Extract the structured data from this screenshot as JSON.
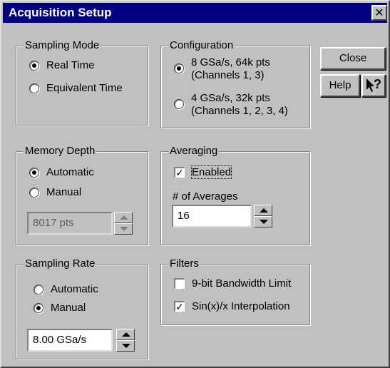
{
  "window": {
    "title": "Acquisition Setup",
    "close_glyph": "✕"
  },
  "sampling_mode": {
    "legend": "Sampling Mode",
    "options": [
      {
        "label": "Real Time",
        "selected": true
      },
      {
        "label": "Equivalent Time",
        "selected": false
      }
    ]
  },
  "configuration": {
    "legend": "Configuration",
    "options": [
      {
        "line1": "8 GSa/s, 64k pts",
        "line2": "(Channels 1, 3)",
        "selected": true
      },
      {
        "line1": "4 GSa/s, 32k pts",
        "line2": "(Channels 1, 2, 3, 4)",
        "selected": false
      }
    ]
  },
  "buttons": {
    "close": "Close",
    "help": "Help",
    "whats_this_glyph": "?"
  },
  "memory_depth": {
    "legend": "Memory Depth",
    "options": [
      {
        "label": "Automatic",
        "selected": true
      },
      {
        "label": "Manual",
        "selected": false
      }
    ],
    "value": "8017 pts"
  },
  "averaging": {
    "legend": "Averaging",
    "enabled_label": "Enabled",
    "enabled_check": "✓",
    "count_label": "# of Averages",
    "count_value": "16"
  },
  "sampling_rate": {
    "legend": "Sampling Rate",
    "options": [
      {
        "label": "Automatic",
        "selected": false
      },
      {
        "label": "Manual",
        "selected": true
      }
    ],
    "value": "8.00 GSa/s"
  },
  "filters": {
    "legend": "Filters",
    "bandwidth_label": "9-bit Bandwidth Limit",
    "bandwidth_check": "",
    "sinx_label": "Sin(x)/x Interpolation",
    "sinx_check": "✓"
  }
}
